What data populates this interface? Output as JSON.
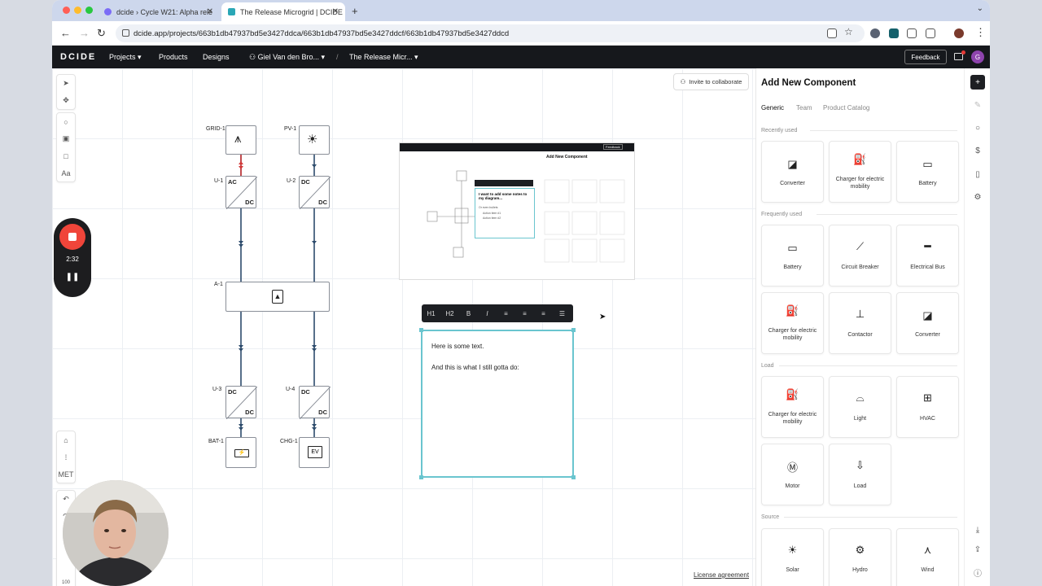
{
  "browser": {
    "tabs": [
      {
        "title": "dcide › Cycle W21: Alpha rele"
      },
      {
        "title": "The Release Microgrid | DCIDE"
      }
    ],
    "url": "dcide.app/projects/663b1db47937bd5e3427ddca/663b1db47937bd5e3427ddcf/663b1db47937bd5e3427ddcd"
  },
  "app": {
    "logo": "DCIDE",
    "nav": {
      "projects": "Projects",
      "products": "Products",
      "designs": "Designs"
    },
    "breadcrumb": {
      "user": "Giel Van den Bro...",
      "separator": "/",
      "project": "The Release Micr..."
    },
    "feedback": "Feedback",
    "avatar_letter": "G"
  },
  "canvas": {
    "invite": "Invite to collaborate",
    "left_tools": {
      "text_tool": "Aa",
      "met": "MET",
      "zoom": "100"
    },
    "license": "License agreement",
    "nodes": {
      "grid": "GRID-1",
      "pv": "PV-1",
      "u1": "U-1",
      "u2": "U-2",
      "a1": "A-1",
      "u3": "U-3",
      "u4": "U-4",
      "bat": "BAT-1",
      "chg": "CHG-1",
      "ac": "AC",
      "dc": "DC",
      "ev": "EV"
    },
    "note": {
      "line1": "Here is some text.",
      "line2": "And this is what I still gotta do:"
    },
    "toolbar": [
      "H1",
      "H2",
      "B",
      "I",
      "≡",
      "≡",
      "≡",
      "☰"
    ],
    "thumbnail": {
      "note_title": "I want to add some notes to my diagram...",
      "note_sub": "Or even bullets",
      "item1": "Action item #1",
      "item2": "Action item #2",
      "panel_title": "Add New Component",
      "feedback": "Feedback"
    }
  },
  "recorder": {
    "time": "2:32"
  },
  "panel": {
    "title": "Add New Component",
    "tabs": {
      "generic": "Generic",
      "team": "Team",
      "catalog": "Product Catalog"
    },
    "sections": {
      "recent": "Recently used",
      "frequent": "Frequently used",
      "load": "Load",
      "source": "Source"
    },
    "recent": [
      {
        "label": "Converter",
        "icon": "converter-icon"
      },
      {
        "label": "Charger for electric mobility",
        "icon": "ev-charger-icon"
      },
      {
        "label": "Battery",
        "icon": "battery-icon"
      }
    ],
    "frequent": [
      {
        "label": "Battery",
        "icon": "battery-icon"
      },
      {
        "label": "Circuit Breaker",
        "icon": "circuit-breaker-icon"
      },
      {
        "label": "Electrical Bus",
        "icon": "bus-icon"
      },
      {
        "label": "Charger for electric mobility",
        "icon": "ev-charger-icon"
      },
      {
        "label": "Contactor",
        "icon": "contactor-icon"
      },
      {
        "label": "Converter",
        "icon": "converter-icon"
      }
    ],
    "load": [
      {
        "label": "Charger for electric mobility",
        "icon": "ev-charger-icon"
      },
      {
        "label": "Light",
        "icon": "light-icon"
      },
      {
        "label": "HVAC",
        "icon": "hvac-icon"
      },
      {
        "label": "Motor",
        "icon": "motor-icon"
      },
      {
        "label": "Load",
        "icon": "load-icon"
      }
    ],
    "source": [
      {
        "label": "Solar",
        "icon": "solar-icon"
      },
      {
        "label": "Hydro",
        "icon": "hydro-icon"
      },
      {
        "label": "Wind",
        "icon": "wind-icon"
      }
    ]
  }
}
